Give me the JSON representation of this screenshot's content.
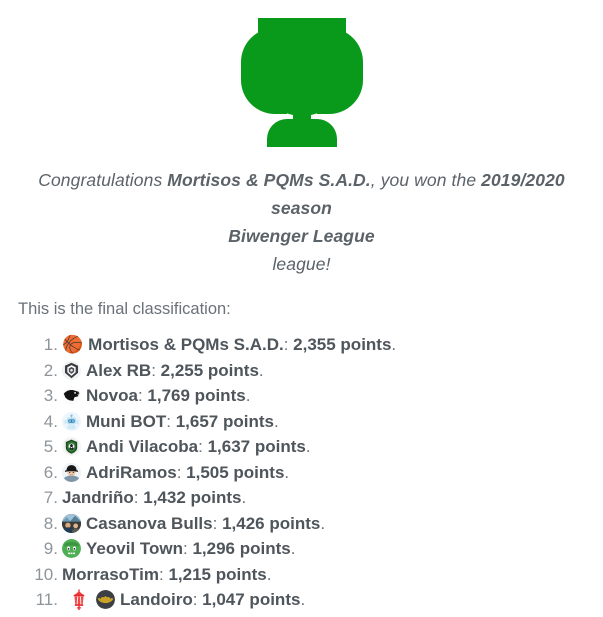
{
  "icon": {
    "name": "trophy-icon",
    "color": "#099a1c"
  },
  "congrats": {
    "prefix": "Congratulations ",
    "team": "Mortisos & PQMs S.A.D.",
    "middle": ", you won the ",
    "season": "2019/2020 season",
    "league_name": "Biwenger League",
    "suffix": "league!"
  },
  "intro": "This is the final classification:",
  "list_suffix": ".",
  "points_label": "points",
  "separator": ": ",
  "ranking": [
    {
      "rank": "1.",
      "avatar": "basketball-emoji",
      "avatar_kind": "emoji",
      "emoji": "🏀",
      "name": "Mortisos & PQMs S.A.D.",
      "points": "2,355 points"
    },
    {
      "rank": "2.",
      "avatar": "crest-badge-avatar",
      "avatar_kind": "image",
      "name": "Alex RB",
      "points": "2,255 points"
    },
    {
      "rank": "3.",
      "avatar": "panther-logo-avatar",
      "avatar_kind": "image",
      "name": "Novoa",
      "points": "1,769 points"
    },
    {
      "rank": "4.",
      "avatar": "robot-avatar",
      "avatar_kind": "image",
      "name": "Muni BOT",
      "points": "1,657 points"
    },
    {
      "rank": "5.",
      "avatar": "green-shield-crest-avatar",
      "avatar_kind": "image",
      "name": "Andi Vilacoba",
      "points": "1,637 points"
    },
    {
      "rank": "6.",
      "avatar": "person-with-cap-avatar",
      "avatar_kind": "image",
      "name": "AdriRamos",
      "points": "1,505 points"
    },
    {
      "rank": "7.",
      "avatar": null,
      "avatar_kind": "none",
      "name": "Jandriño",
      "points": "1,432 points"
    },
    {
      "rank": "8.",
      "avatar": "photo-avatar",
      "avatar_kind": "image",
      "name": "Casanova Bulls",
      "points": "1,426 points"
    },
    {
      "rank": "9.",
      "avatar": "green-face-avatar",
      "avatar_kind": "image",
      "name": "Yeovil Town",
      "points": "1,296 points"
    },
    {
      "rank": "10.",
      "avatar": null,
      "avatar_kind": "none",
      "name": "MorrasoTim",
      "points": "1,215 points"
    },
    {
      "rank": "11.",
      "avatar": "bat-logo-avatar",
      "avatar_kind": "image",
      "extra_icon": "red-lantern-emoji",
      "name": "Landoiro",
      "points": "1,047 points"
    }
  ]
}
